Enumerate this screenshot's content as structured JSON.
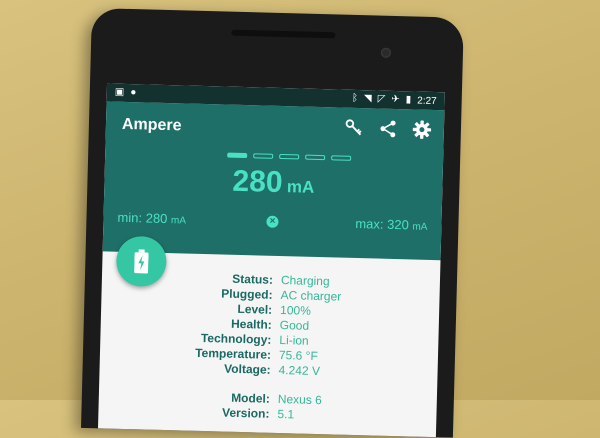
{
  "status_bar": {
    "time": "2:27",
    "left_icons": [
      "image-notification-icon",
      "app-notification-icon"
    ],
    "right_icons": [
      "bluetooth-icon",
      "wifi-icon",
      "no-signal-icon",
      "airplane-icon",
      "battery-icon"
    ]
  },
  "app": {
    "title": "Ampere"
  },
  "toolbar": {
    "actions": [
      "key-icon",
      "share-icon",
      "settings-icon"
    ]
  },
  "meter": {
    "page_indicators": 5,
    "active_page": 0,
    "current_value": "280",
    "current_unit": "mA",
    "min_label": "min:",
    "min_value": "280",
    "min_unit": "mA",
    "max_label": "max:",
    "max_value": "320",
    "max_unit": "mA"
  },
  "fab": {
    "icon": "battery-charging-icon"
  },
  "info": [
    {
      "label": "Status:",
      "value": "Charging"
    },
    {
      "label": "Plugged:",
      "value": "AC charger"
    },
    {
      "label": "Level:",
      "value": "100%"
    },
    {
      "label": "Health:",
      "value": "Good"
    },
    {
      "label": "Technology:",
      "value": "Li-ion"
    },
    {
      "label": "Temperature:",
      "value": "75.6 °F"
    },
    {
      "label": "Voltage:",
      "value": "4.242 V"
    }
  ],
  "device": [
    {
      "label": "Model:",
      "value": "Nexus 6"
    },
    {
      "label": "Version:",
      "value": "5.1"
    }
  ],
  "colors": {
    "header": "#1e6f68",
    "accent": "#49e1c3",
    "fab": "#35c7a3",
    "label": "#1a6a63",
    "value": "#35b79a"
  }
}
